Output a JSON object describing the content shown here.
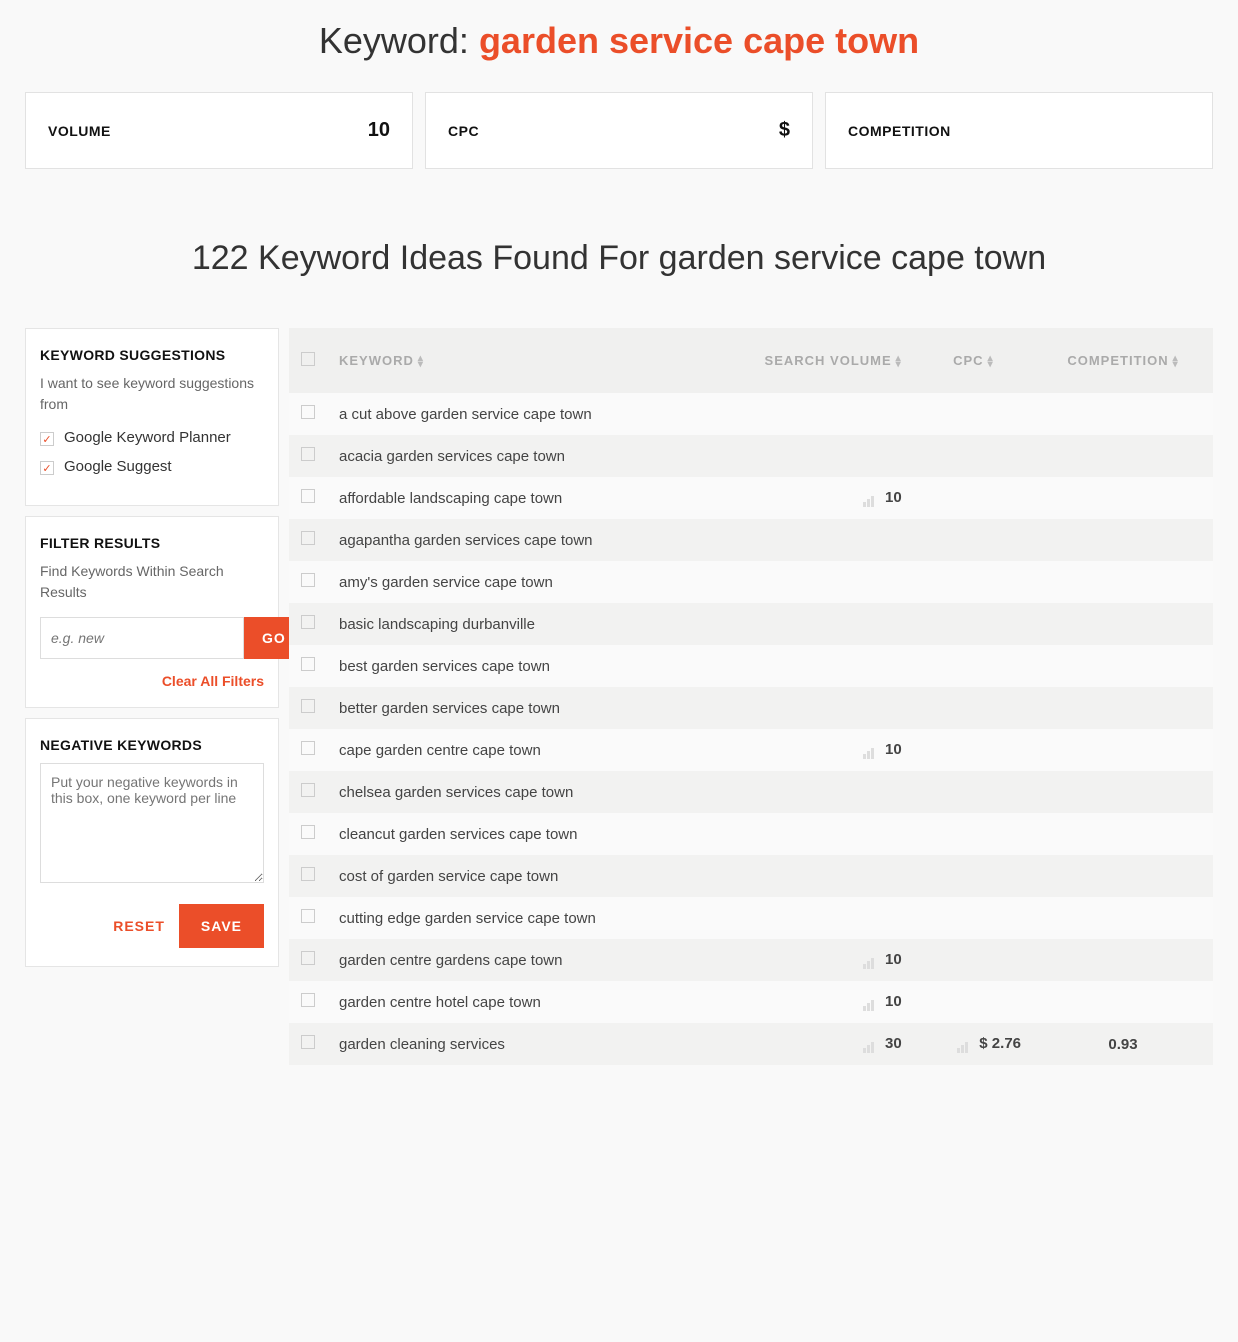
{
  "header": {
    "prefix": "Keyword: ",
    "keyword": "garden service cape town"
  },
  "stats": {
    "volume_label": "VOLUME",
    "volume_value": "10",
    "cpc_label": "CPC",
    "cpc_value": "$",
    "competition_label": "COMPETITION",
    "competition_value": ""
  },
  "ideas_title": "122 Keyword Ideas Found For garden service cape town",
  "sidebar": {
    "suggestions": {
      "title": "KEYWORD SUGGESTIONS",
      "sub": "I want to see keyword suggestions from",
      "sources": [
        {
          "label": "Google Keyword Planner",
          "checked": true
        },
        {
          "label": "Google Suggest",
          "checked": true
        }
      ]
    },
    "filter": {
      "title": "FILTER RESULTS",
      "sub": "Find Keywords Within Search Results",
      "placeholder": "e.g. new",
      "go": "GO",
      "clear": "Clear All Filters"
    },
    "negative": {
      "title": "NEGATIVE KEYWORDS",
      "placeholder": "Put your negative keywords in this box, one keyword per line",
      "reset": "RESET",
      "save": "SAVE"
    }
  },
  "table": {
    "headers": {
      "keyword": "KEYWORD",
      "volume": "SEARCH VOLUME",
      "cpc": "CPC",
      "competition": "COMPETITION"
    },
    "rows": [
      {
        "keyword": "a cut above garden service cape town",
        "volume": "",
        "cpc": "",
        "competition": ""
      },
      {
        "keyword": "acacia garden services cape town",
        "volume": "",
        "cpc": "",
        "competition": ""
      },
      {
        "keyword": "affordable landscaping cape town",
        "volume": "10",
        "cpc": "",
        "competition": ""
      },
      {
        "keyword": "agapantha garden services cape town",
        "volume": "",
        "cpc": "",
        "competition": ""
      },
      {
        "keyword": "amy's garden service cape town",
        "volume": "",
        "cpc": "",
        "competition": ""
      },
      {
        "keyword": "basic landscaping durbanville",
        "volume": "",
        "cpc": "",
        "competition": ""
      },
      {
        "keyword": "best garden services cape town",
        "volume": "",
        "cpc": "",
        "competition": ""
      },
      {
        "keyword": "better garden services cape town",
        "volume": "",
        "cpc": "",
        "competition": ""
      },
      {
        "keyword": "cape garden centre cape town",
        "volume": "10",
        "cpc": "",
        "competition": ""
      },
      {
        "keyword": "chelsea garden services cape town",
        "volume": "",
        "cpc": "",
        "competition": ""
      },
      {
        "keyword": "cleancut garden services cape town",
        "volume": "",
        "cpc": "",
        "competition": ""
      },
      {
        "keyword": "cost of garden service cape town",
        "volume": "",
        "cpc": "",
        "competition": ""
      },
      {
        "keyword": "cutting edge garden service cape town",
        "volume": "",
        "cpc": "",
        "competition": ""
      },
      {
        "keyword": "garden centre gardens cape town",
        "volume": "10",
        "cpc": "",
        "competition": ""
      },
      {
        "keyword": "garden centre hotel cape town",
        "volume": "10",
        "cpc": "",
        "competition": ""
      },
      {
        "keyword": "garden cleaning services",
        "volume": "30",
        "cpc": "$ 2.76",
        "competition": "0.93"
      }
    ]
  }
}
